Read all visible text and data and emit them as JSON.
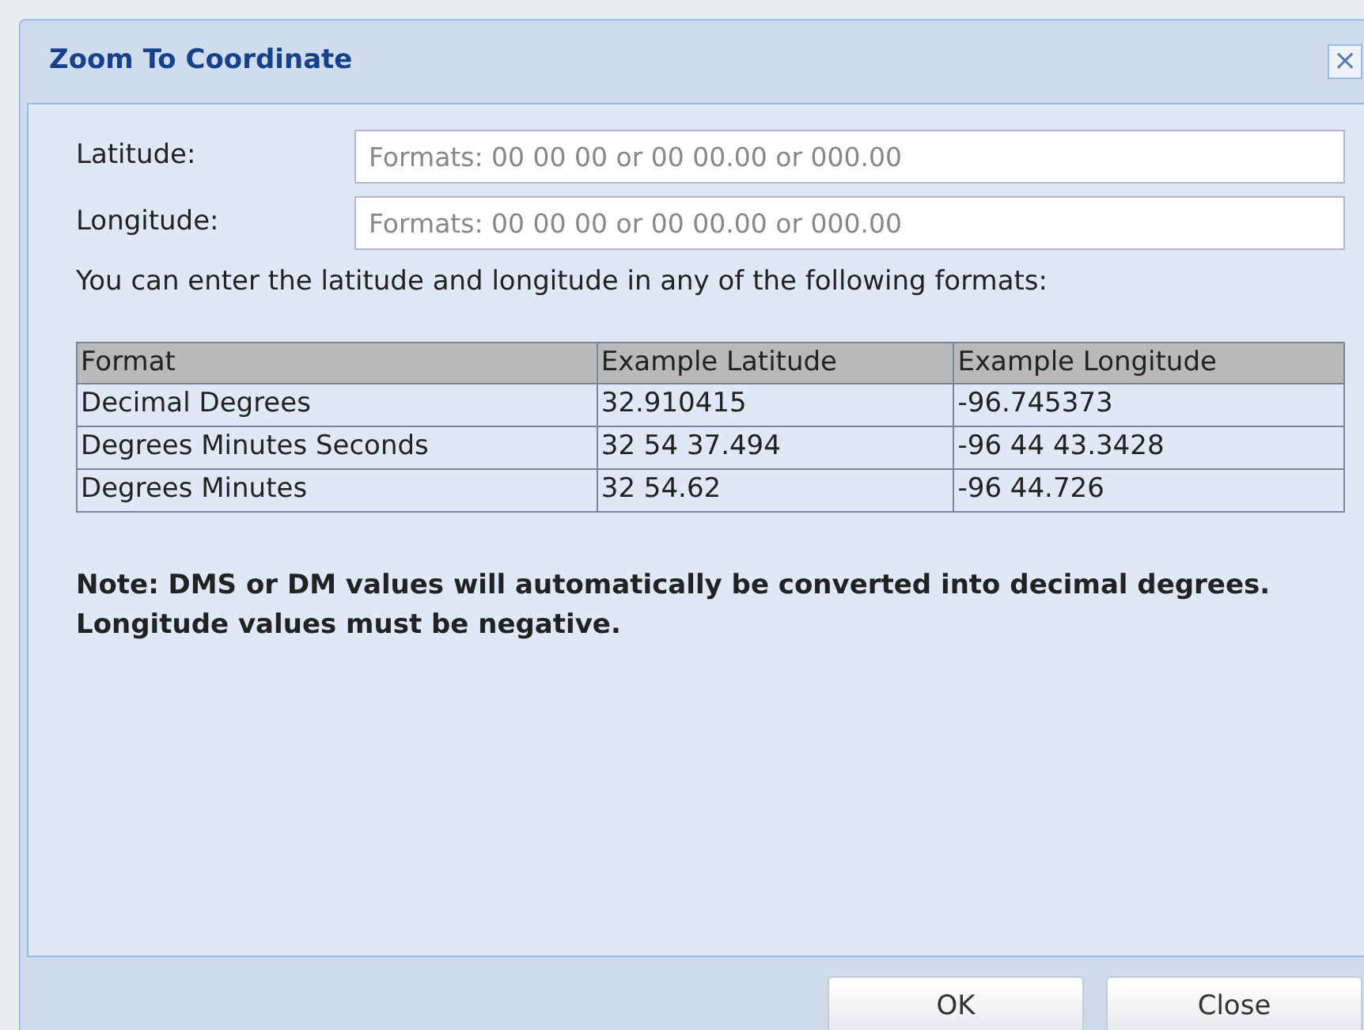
{
  "dialog": {
    "title": "Zoom To Coordinate",
    "close": "×"
  },
  "fields": [
    {
      "label": "Latitude:",
      "placeholder": "Formats: 00 00 00 or 00 00.00 or 000.00"
    },
    {
      "label": "Longitude:",
      "placeholder": "Formats: 00 00 00 or 00 00.00 or 000.00"
    }
  ],
  "intro": "You can enter the latitude and longitude in any of the following formats:",
  "table": {
    "columns": [
      "Format",
      "Example Latitude",
      "Example Longitude"
    ],
    "rows": [
      [
        "Decimal Degrees",
        "32.910415",
        "-96.745373"
      ],
      [
        "Degrees Minutes Seconds",
        "32 54 37.494",
        "-96 44 43.3428"
      ],
      [
        "Degrees Minutes",
        "32 54.62",
        "-96 44.726"
      ]
    ]
  },
  "note": "Note: DMS or DM values will automatically be converted into decimal degrees. Longitude values must be negative.",
  "buttons": [
    "OK",
    "Close"
  ]
}
